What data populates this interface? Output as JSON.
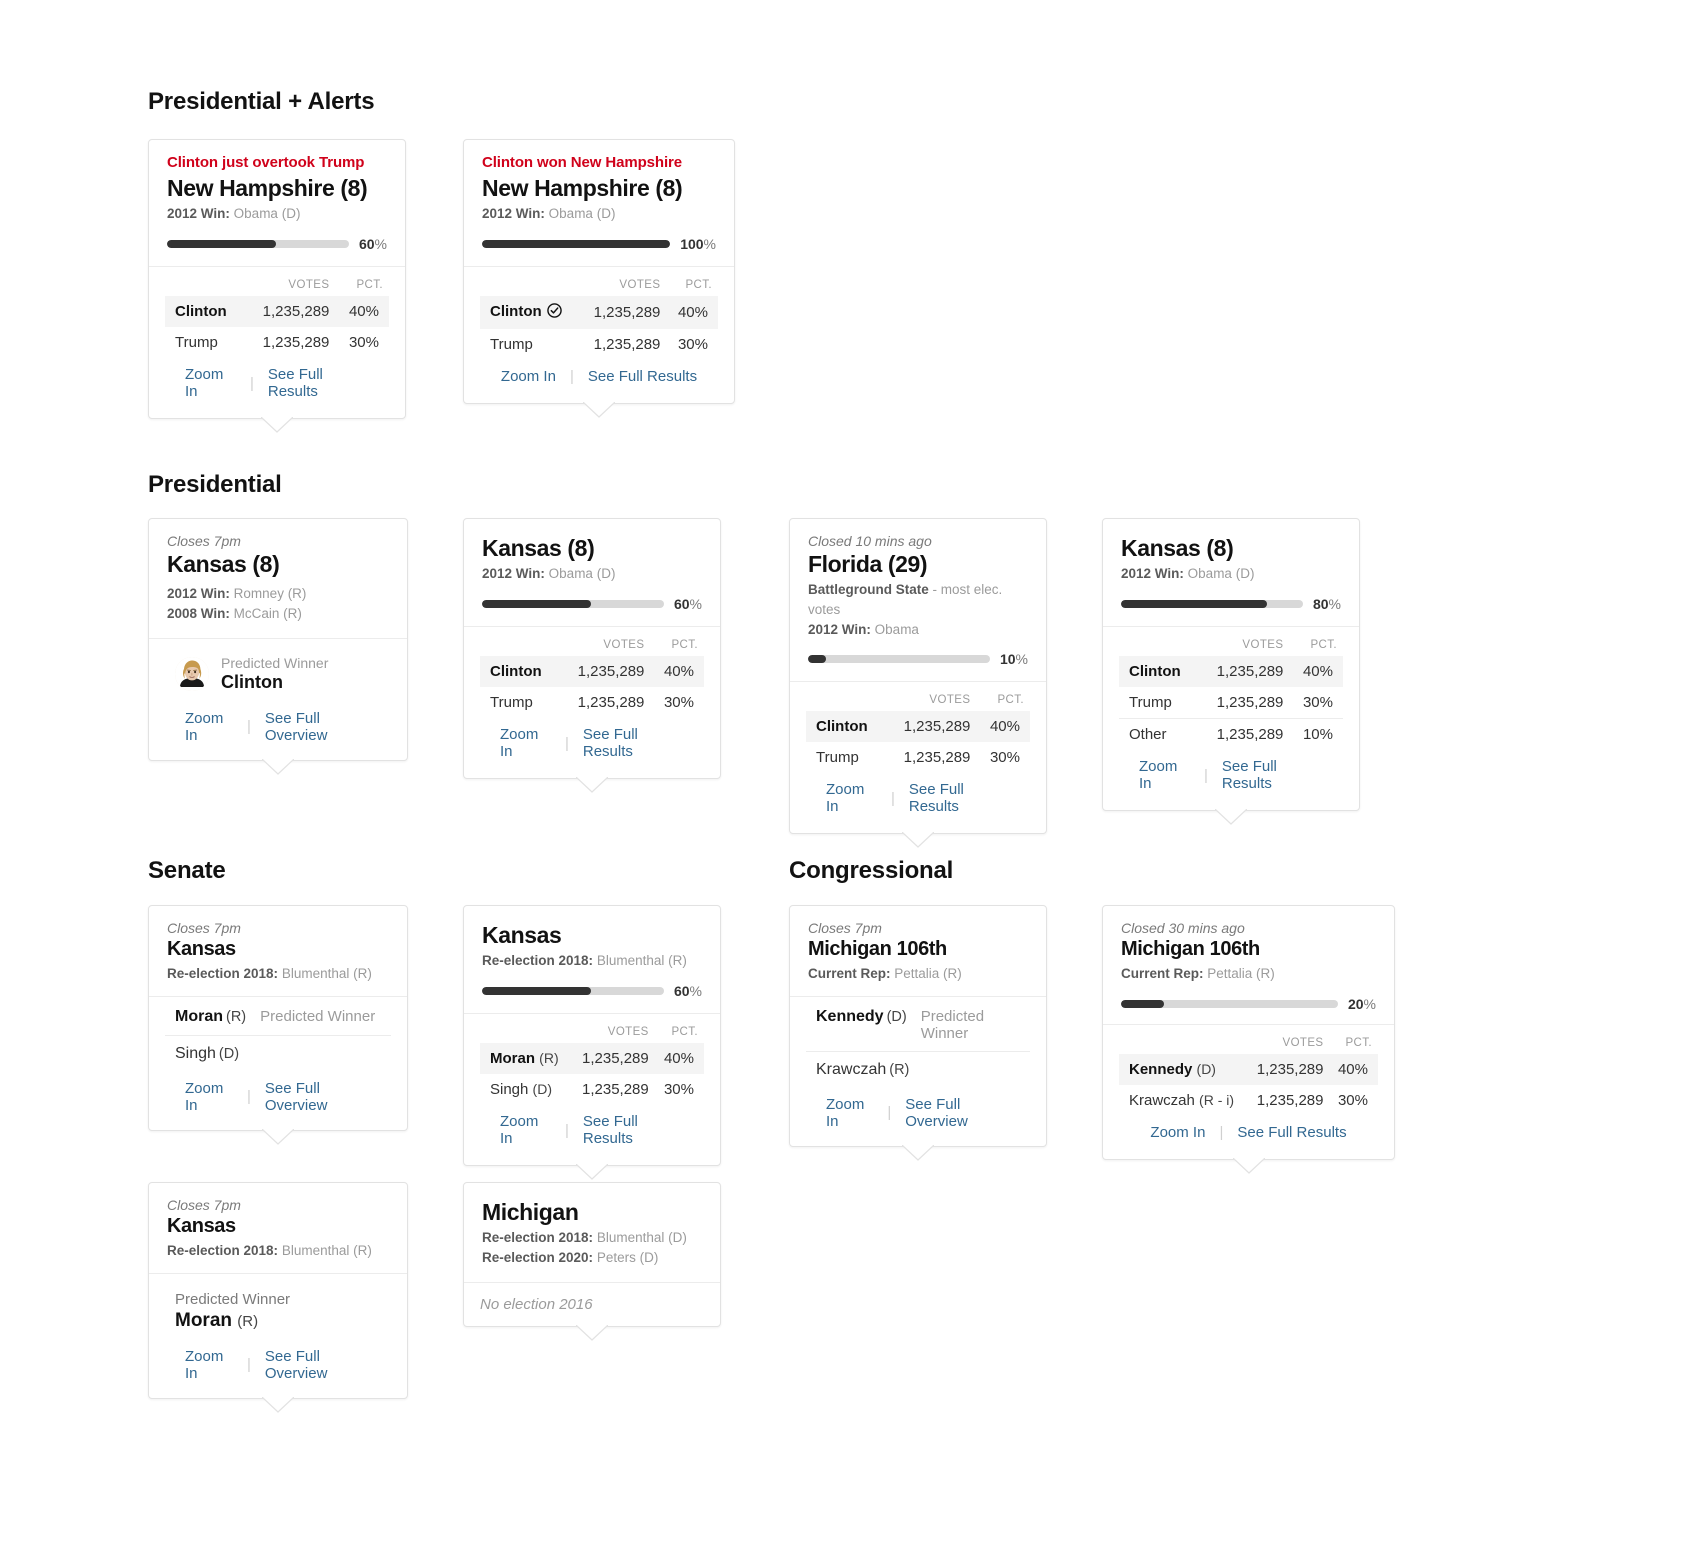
{
  "sections": [
    {
      "id": "presidential-alerts",
      "title": "Presidential + Alerts"
    },
    {
      "id": "presidential",
      "title": "Presidential"
    },
    {
      "id": "senate",
      "title": "Senate"
    },
    {
      "id": "congressional",
      "title": "Congressional"
    }
  ],
  "labels": {
    "votes": "VOTES",
    "pct": "PCT.",
    "zoom_in": "Zoom In",
    "see_full_results": "See Full Results",
    "see_full_overview": "See Full Overview",
    "predicted_winner": "Predicted Winner",
    "separator": "|"
  },
  "colors": {
    "alert_red": "#d0021b",
    "link_blue": "#326891",
    "progress_fill": "#333333",
    "progress_track": "#d8d8d8",
    "leader_row_bg": "#f4f4f4",
    "card_border": "#e2e2e2"
  },
  "cards": {
    "nh_alert_overtook": {
      "alert": "Clinton just overtook Trump",
      "place": "New Hampshire (8)",
      "meta": {
        "prefix": "2012 Win:",
        "value": "Obama (D)"
      },
      "progress": {
        "percent": 60,
        "label": "60",
        "pctsign": "%"
      },
      "rows": [
        {
          "name": "Clinton",
          "votes": "1,235,289",
          "pct": "40%",
          "leader": true,
          "check": false
        },
        {
          "name": "Trump",
          "votes": "1,235,289",
          "pct": "30%",
          "leader": false,
          "check": false
        }
      ],
      "links": [
        "Zoom In",
        "See Full Results"
      ]
    },
    "nh_alert_won": {
      "alert": "Clinton won New Hampshire",
      "place": "New Hampshire (8)",
      "meta": {
        "prefix": "2012 Win:",
        "value": "Obama (D)"
      },
      "progress": {
        "percent": 100,
        "label": "100",
        "pctsign": "%"
      },
      "rows": [
        {
          "name": "Clinton",
          "votes": "1,235,289",
          "pct": "40%",
          "leader": true,
          "check": true
        },
        {
          "name": "Trump",
          "votes": "1,235,289",
          "pct": "30%",
          "leader": false,
          "check": false
        }
      ],
      "links": [
        "Zoom In",
        "See Full Results"
      ]
    },
    "kansas_pres_closes": {
      "eyebrow": "Closes 7pm",
      "place": "Kansas (8)",
      "meta_lines": [
        {
          "prefix": "2012 Win:",
          "value": "Romney (R)"
        },
        {
          "prefix": "2008 Win:",
          "value": "McCain (R)"
        }
      ],
      "predicted": {
        "label": "Predicted Winner",
        "name": "Clinton",
        "avatar": "clinton-portrait-avatar"
      },
      "links": [
        "Zoom In",
        "See Full Overview"
      ]
    },
    "kansas_pres_60": {
      "place": "Kansas (8)",
      "meta": {
        "prefix": "2012 Win:",
        "value": "Obama (D)"
      },
      "progress": {
        "percent": 60,
        "label": "60",
        "pctsign": "%"
      },
      "rows": [
        {
          "name": "Clinton",
          "votes": "1,235,289",
          "pct": "40%",
          "leader": true
        },
        {
          "name": "Trump",
          "votes": "1,235,289",
          "pct": "30%",
          "leader": false
        }
      ],
      "links": [
        "Zoom In",
        "See Full Results"
      ]
    },
    "florida_pres": {
      "eyebrow": "Closed 10 mins ago",
      "place": "Florida (29)",
      "meta_lines": [
        {
          "prefix": "Battleground State",
          "value": "- most elec. votes"
        },
        {
          "prefix": "2012 Win:",
          "value": "Obama"
        }
      ],
      "progress": {
        "percent": 10,
        "label": "10",
        "pctsign": "%"
      },
      "rows": [
        {
          "name": "Clinton",
          "votes": "1,235,289",
          "pct": "40%",
          "leader": true
        },
        {
          "name": "Trump",
          "votes": "1,235,289",
          "pct": "30%",
          "leader": false
        }
      ],
      "links": [
        "Zoom In",
        "See Full Results"
      ]
    },
    "kansas_pres_80": {
      "place": "Kansas (8)",
      "meta": {
        "prefix": "2012 Win:",
        "value": "Obama (D)"
      },
      "progress": {
        "percent": 80,
        "label": "80",
        "pctsign": "%"
      },
      "rows": [
        {
          "name": "Clinton",
          "votes": "1,235,289",
          "pct": "40%",
          "leader": true
        },
        {
          "name": "Trump",
          "votes": "1,235,289",
          "pct": "30%",
          "leader": false
        },
        {
          "name": "Other",
          "votes": "1,235,289",
          "pct": "10%",
          "leader": false
        }
      ],
      "links": [
        "Zoom In",
        "See Full Results"
      ]
    },
    "kansas_senate_closes": {
      "eyebrow": "Closes 7pm",
      "place": "Kansas",
      "meta": {
        "prefix": "Re-election 2018:",
        "value": "Blumenthal (R)"
      },
      "candidates": [
        {
          "name": "Moran",
          "party": "(R)",
          "bold": true,
          "tag": "Predicted Winner"
        },
        {
          "name": "Singh",
          "party": "(D)",
          "bold": false,
          "tag": ""
        }
      ],
      "links": [
        "Zoom In",
        "See Full Overview"
      ]
    },
    "kansas_senate_60": {
      "place": "Kansas",
      "meta": {
        "prefix": "Re-election 2018:",
        "value": "Blumenthal (R)"
      },
      "progress": {
        "percent": 60,
        "label": "60",
        "pctsign": "%"
      },
      "rows": [
        {
          "name": "Moran",
          "party": "(R)",
          "votes": "1,235,289",
          "pct": "40%",
          "leader": true
        },
        {
          "name": "Singh",
          "party": "(D)",
          "votes": "1,235,289",
          "pct": "30%",
          "leader": false
        }
      ],
      "links": [
        "Zoom In",
        "See Full Results"
      ]
    },
    "kansas_senate_pw": {
      "eyebrow": "Closes 7pm",
      "place": "Kansas",
      "meta": {
        "prefix": "Re-election 2018:",
        "value": "Blumenthal (R)"
      },
      "predicted": {
        "label": "Predicted Winner",
        "name": "Moran",
        "party": "(R)"
      },
      "links": [
        "Zoom In",
        "See Full Overview"
      ]
    },
    "michigan_senate_none": {
      "place": "Michigan",
      "meta_lines": [
        {
          "prefix": "Re-election 2018:",
          "value": "Blumenthal (D)"
        },
        {
          "prefix": "Re-election 2020:",
          "value": "Peters (D)"
        }
      ],
      "no_election": "No election 2016"
    },
    "michigan_cong_closes": {
      "eyebrow": "Closes 7pm",
      "place": "Michigan 106th",
      "meta": {
        "prefix": "Current Rep:",
        "value": "Pettalia (R)"
      },
      "candidates": [
        {
          "name": "Kennedy",
          "party": "(D)",
          "bold": true,
          "tag": "Predicted Winner"
        },
        {
          "name": "Krawczah",
          "party": "(R)",
          "bold": false,
          "tag": ""
        }
      ],
      "links": [
        "Zoom In",
        "See Full Overview"
      ]
    },
    "michigan_cong_20": {
      "eyebrow": "Closed 30 mins ago",
      "place": "Michigan 106th",
      "meta": {
        "prefix": "Current Rep:",
        "value": "Pettalia (R)"
      },
      "progress": {
        "percent": 20,
        "label": "20",
        "pctsign": "%"
      },
      "rows": [
        {
          "name": "Kennedy",
          "party": "(D)",
          "votes": "1,235,289",
          "pct": "40%",
          "leader": true
        },
        {
          "name": "Krawczah",
          "party": "(R - i)",
          "votes": "1,235,289",
          "pct": "30%",
          "leader": false
        }
      ],
      "links": [
        "Zoom In",
        "See Full Results"
      ]
    }
  }
}
